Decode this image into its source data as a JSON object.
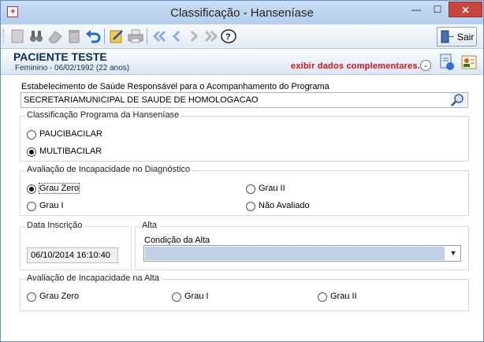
{
  "window": {
    "title": "Classificação - Hanseníase",
    "minimize": "—",
    "maximize": "☐",
    "close": "✕"
  },
  "toolbar": {
    "sair_label": "Sair"
  },
  "patient": {
    "name": "PACIENTE TESTE",
    "info": "Feminino - 06/02/1992 (22 anos)",
    "exibir": "exibir dados complementares...",
    "chevron": "⌄"
  },
  "estabelecimento": {
    "label": "Estabelecimento de Saúde Responsável para o Acompanhamento do Programa",
    "value": "SECRETARIAMUNICIPAL DE SAUDE DE HOMOLOGACAO"
  },
  "classificacao": {
    "title": "Classificação Programa da Hanseníase",
    "options": [
      {
        "label": "PAUCIBACILAR",
        "checked": false
      },
      {
        "label": "MULTIBACILAR",
        "checked": true
      }
    ]
  },
  "incapacidade_diag": {
    "title": "Avaliação de Incapacidade no Diagnóstico",
    "options": [
      {
        "label": "Grau Zero",
        "checked": true
      },
      {
        "label": "Grau II",
        "checked": false
      },
      {
        "label": "Grau I",
        "checked": false
      },
      {
        "label": "Não Avaliado",
        "checked": false
      }
    ]
  },
  "inscricao": {
    "title": "Data Inscrição",
    "value": "06/10/2014 16:10:40"
  },
  "alta": {
    "title": "Alta",
    "condicao_label": "Condição da Alta",
    "condicao_value": "",
    "arrow": "▼"
  },
  "incapacidade_alta": {
    "title": "Avaliação de Incapacidade na Alta",
    "options": [
      {
        "label": "Grau Zero",
        "checked": false
      },
      {
        "label": "Grau I",
        "checked": false
      },
      {
        "label": "Grau II",
        "checked": false
      }
    ]
  }
}
